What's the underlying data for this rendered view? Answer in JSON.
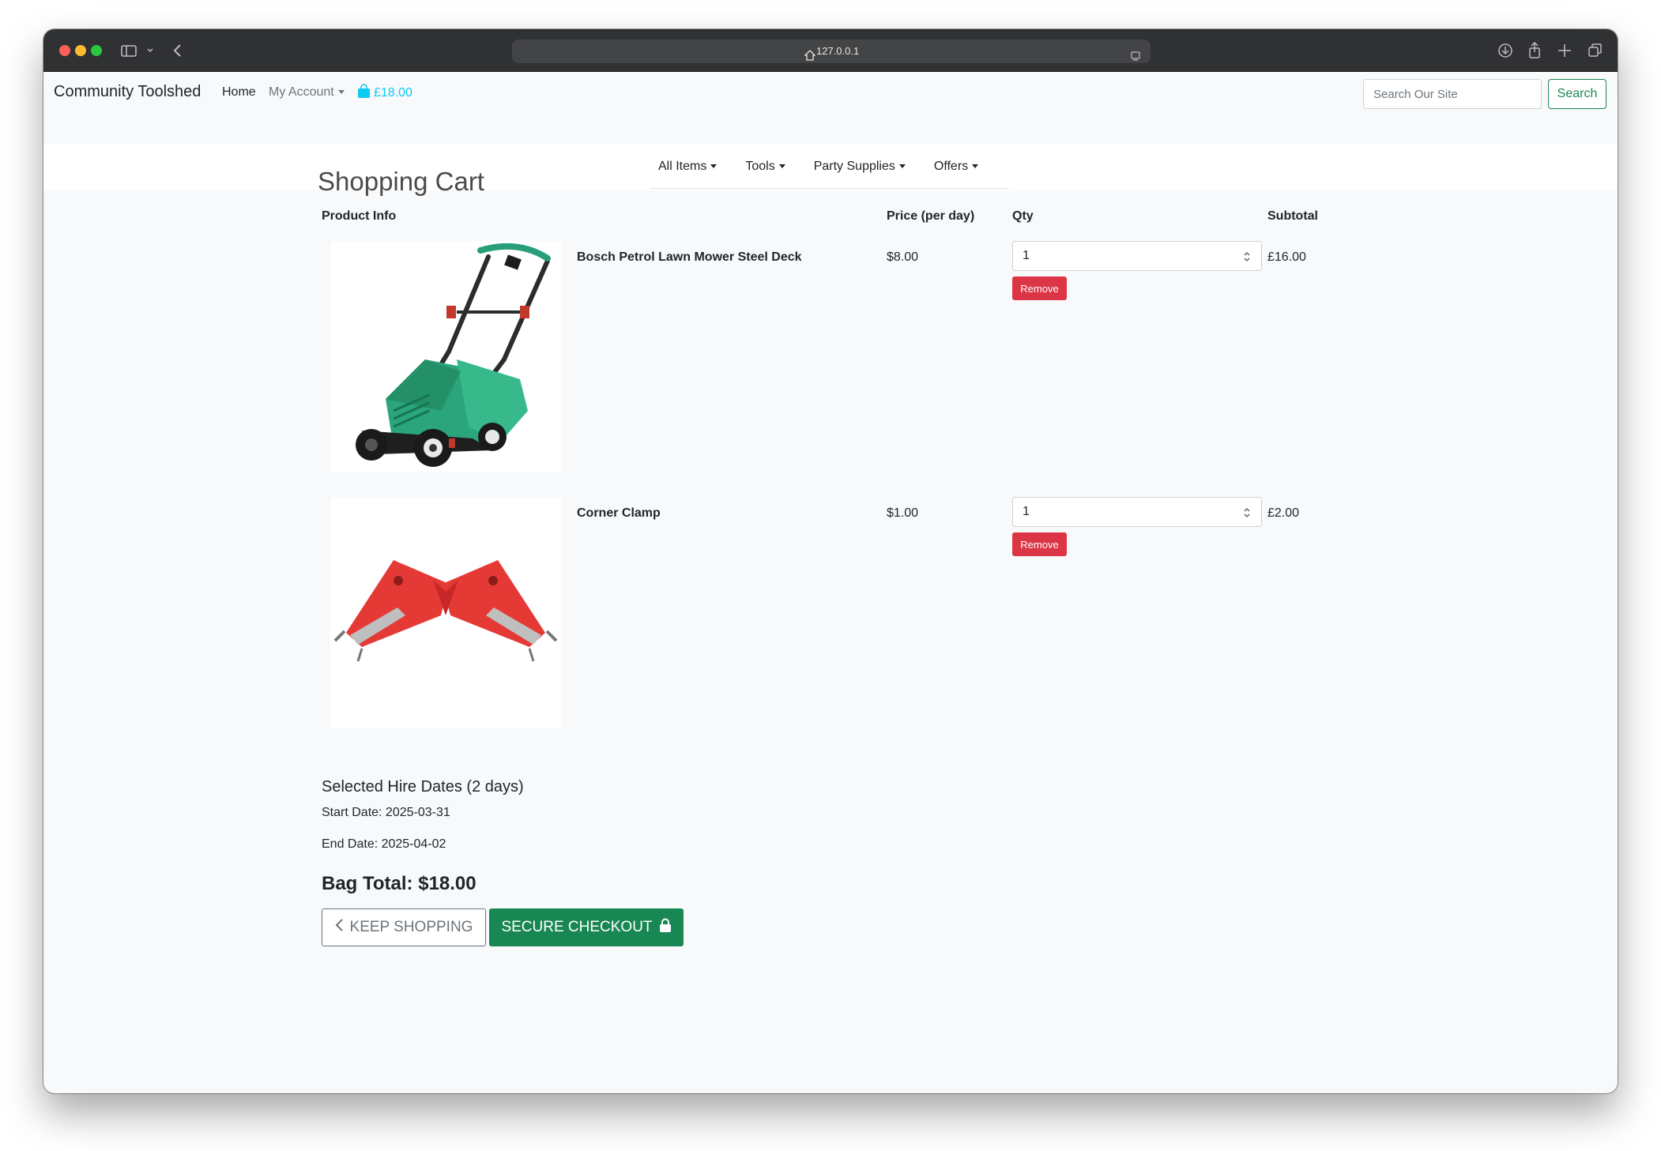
{
  "browser": {
    "url": "127.0.0.1"
  },
  "nav": {
    "brand": "Community Toolshed",
    "home": "Home",
    "account": "My Account",
    "bag_total": "£18.00",
    "search_placeholder": "Search Our Site",
    "search_button": "Search"
  },
  "categories": [
    {
      "label": "All Items"
    },
    {
      "label": "Tools"
    },
    {
      "label": "Party Supplies"
    },
    {
      "label": "Offers"
    }
  ],
  "cart": {
    "title": "Shopping Cart",
    "headers": {
      "product": "Product Info",
      "price": "Price (per day)",
      "qty": "Qty",
      "subtotal": "Subtotal"
    },
    "items": [
      {
        "name": "Bosch Petrol Lawn Mower Steel Deck",
        "price": "$8.00",
        "qty": "1",
        "subtotal": "£16.00",
        "remove": "Remove"
      },
      {
        "name": "Corner Clamp",
        "price": "$1.00",
        "qty": "1",
        "subtotal": "£2.00",
        "remove": "Remove"
      }
    ]
  },
  "hire": {
    "title": "Selected Hire Dates (2 days)",
    "start": "Start Date: 2025-03-31",
    "end": "End Date: 2025-04-02"
  },
  "summary": {
    "bag_total": "Bag Total: $18.00",
    "keep_shopping": "Keep Shopping",
    "checkout": "Secure Checkout"
  },
  "colors": {
    "success": "#198754",
    "danger": "#dc3545",
    "info": "#0dcaf0"
  }
}
